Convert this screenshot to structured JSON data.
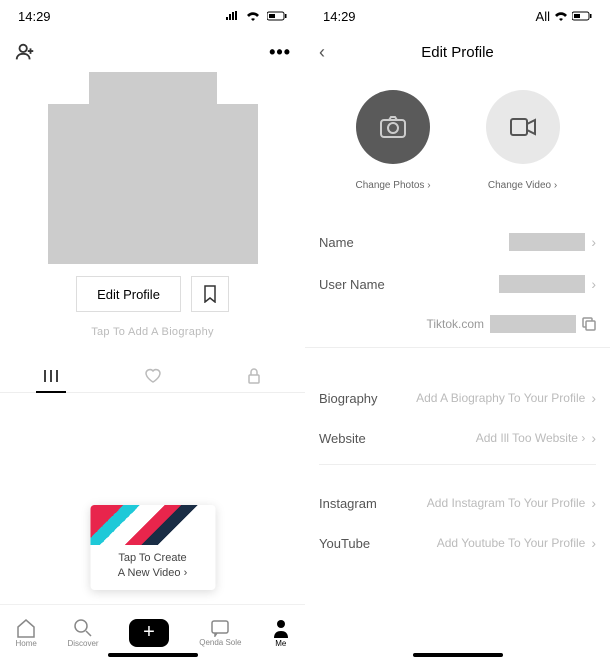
{
  "status": {
    "time": "14:29",
    "right_text": "All"
  },
  "profile": {
    "edit_button": "Edit Profile",
    "bio_prompt": "Tap To Add A Biography",
    "create_video_line1": "Tap To Create",
    "create_video_line2": "A New Video ›"
  },
  "nav": {
    "home": "Home",
    "discover": "Discover",
    "inbox": "Qenda Sole",
    "me": "Me"
  },
  "edit": {
    "title": "Edit Profile",
    "change_photos": "Change Photos ›",
    "change_video": "Change Video ›",
    "name_label": "Name",
    "username_label": "User Name",
    "url_prefix": "Tiktok.com",
    "biography_label": "Biography",
    "biography_value": "Add A Biography To Your Profile",
    "website_label": "Website",
    "website_value": "Add Ill Too Website ›",
    "instagram_label": "Instagram",
    "instagram_value": "Add Instagram To Your Profile",
    "youtube_label": "YouTube",
    "youtube_value": "Add Youtube To Your Profile"
  }
}
